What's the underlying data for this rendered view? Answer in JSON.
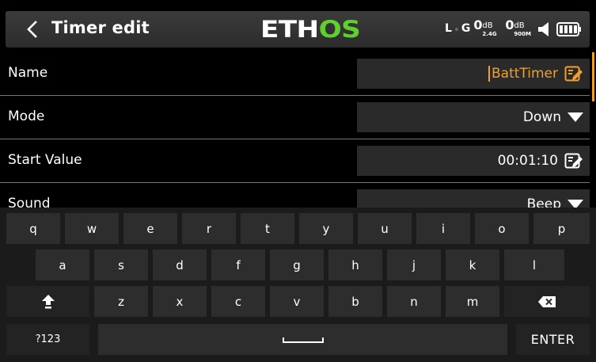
{
  "header": {
    "title": "Timer edit",
    "logo": {
      "part1": "ETH",
      "part2": "OS"
    },
    "status": {
      "rx_l": "L",
      "rx_g": "G",
      "rssi_24": {
        "value": "0",
        "unit": "dB",
        "band": "2.4G"
      },
      "rssi_900": {
        "value": "0",
        "unit": "dB",
        "band": "900M"
      }
    },
    "icons": [
      "back-icon",
      "volume-icon",
      "battery-icon"
    ]
  },
  "form": {
    "rows": [
      {
        "label": "Name",
        "value": "BattTimer",
        "control": "text",
        "icon": "edit-icon"
      },
      {
        "label": "Mode",
        "value": "Down",
        "control": "dropdown",
        "icon": "caret-down-icon"
      },
      {
        "label": "Start Value",
        "value": "00:01:10",
        "control": "time",
        "icon": "edit-icon"
      },
      {
        "label": "Sound",
        "value": "Beep",
        "control": "dropdown",
        "icon": "caret-down-icon"
      }
    ]
  },
  "keyboard": {
    "row1": [
      "q",
      "w",
      "e",
      "r",
      "t",
      "y",
      "u",
      "i",
      "o",
      "p"
    ],
    "row2": [
      "a",
      "s",
      "d",
      "f",
      "g",
      "h",
      "j",
      "k",
      "l"
    ],
    "row3": [
      "z",
      "x",
      "c",
      "v",
      "b",
      "n",
      "m"
    ],
    "numbers_key": "?123",
    "enter_key": "ENTER",
    "icons": [
      "shift-icon",
      "backspace-icon",
      "space-bar-icon"
    ]
  },
  "colors": {
    "accent": "#f0a02a",
    "logo_green": "#5ed12b",
    "field_bg": "#2a2a2a",
    "key_bg": "#2d2d2d",
    "keyboard_bg": "#1b1b1b"
  }
}
